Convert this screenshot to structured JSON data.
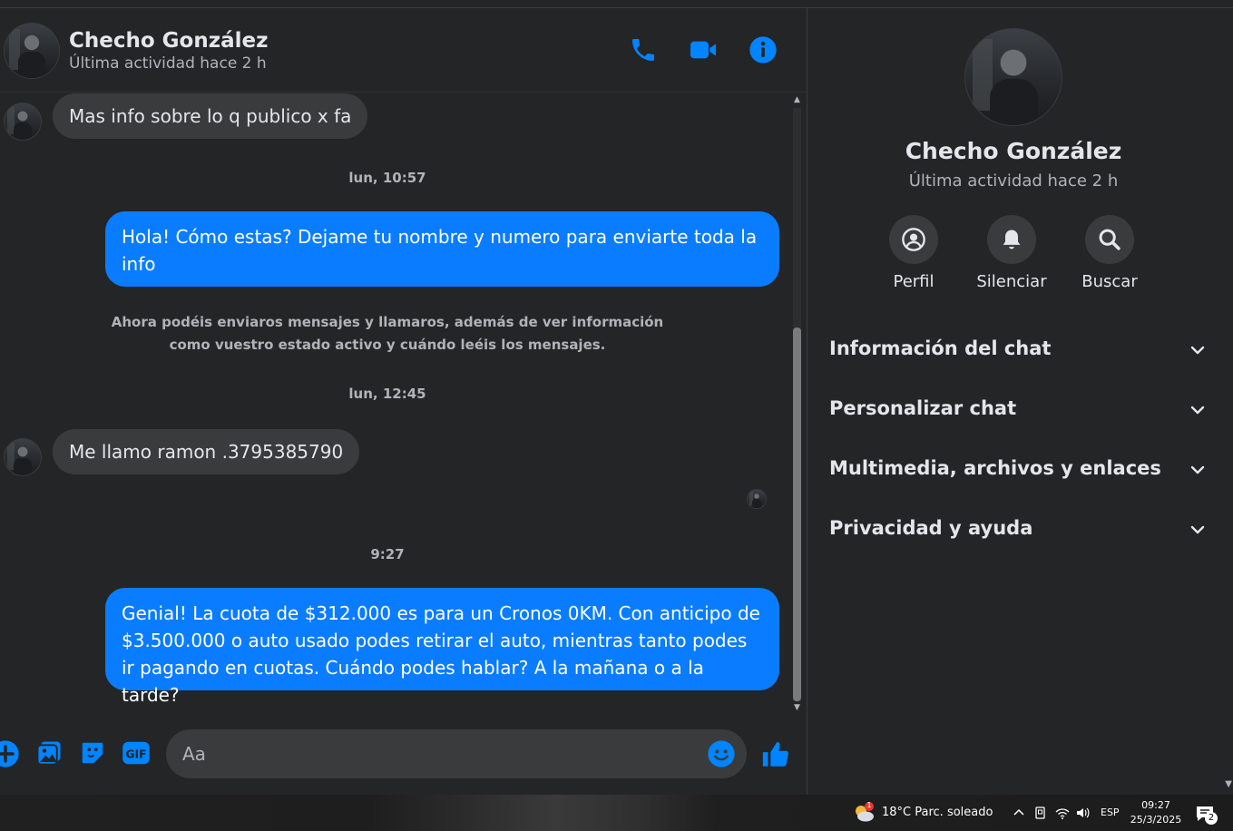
{
  "contact": {
    "name": "Checho González",
    "status": "Última actividad hace 2 h"
  },
  "messages": {
    "m1": "Mas info sobre lo q publico x fa",
    "t1": "lun, 10:57",
    "m2": "Hola! Cómo estas? Dejame tu nombre y numero para enviarte toda la info",
    "note": "Ahora podéis enviaros mensajes y llamaros, además de ver información como vuestro estado activo y cuándo leéis los mensajes.",
    "t2": "lun, 12:45",
    "m3": "Me llamo ramon .3795385790",
    "t3": "9:27",
    "m4": "Genial! La cuota de $312.000 es para un Cronos 0KM. Con anticipo de $3.500.000 o auto usado podes retirar el auto, mientras tanto podes ir pagando en cuotas. Cuándo podes hablar? A la mañana o a la tarde?"
  },
  "composer": {
    "placeholder": "Aa",
    "gif_label": "GIF"
  },
  "side": {
    "actions": [
      {
        "label": "Perfil",
        "icon": "profile-icon"
      },
      {
        "label": "Silenciar",
        "icon": "bell-icon"
      },
      {
        "label": "Buscar",
        "icon": "search-icon"
      }
    ],
    "sections": [
      "Información del chat",
      "Personalizar chat",
      "Multimedia, archivos y enlaces",
      "Privacidad y ayuda"
    ]
  },
  "taskbar": {
    "weather": "18°C  Parc. soleado",
    "weather_badge": "1",
    "lang": "ESP",
    "time": "09:27",
    "date": "25/3/2025",
    "notif_count": "2"
  },
  "colors": {
    "accent": "#0a7cff",
    "icon_blue": "#0084ff",
    "bg": "#242526",
    "bubble_in": "#3a3b3c"
  }
}
